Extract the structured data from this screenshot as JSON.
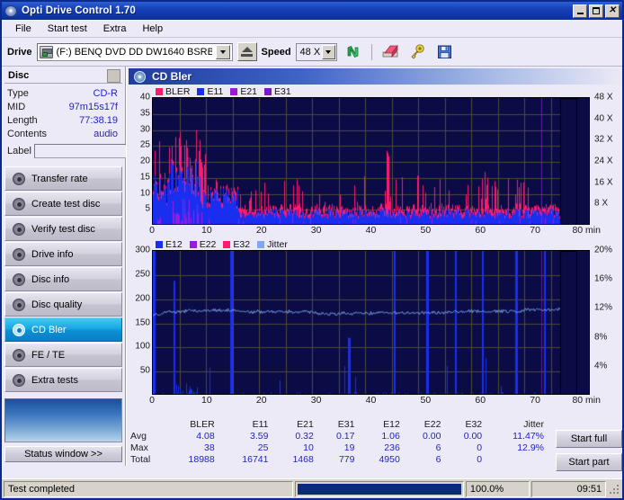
{
  "window": {
    "title": "Opti Drive Control 1.70",
    "icon": "disc-icon",
    "controls": {
      "minimize": "_",
      "maximize": "□",
      "close": "✕"
    }
  },
  "menu": {
    "items": [
      {
        "name": "file",
        "label": "File"
      },
      {
        "name": "start-test",
        "label": "Start test"
      },
      {
        "name": "extra",
        "label": "Extra"
      },
      {
        "name": "help",
        "label": "Help"
      }
    ]
  },
  "toolbar": {
    "drive_label": "Drive",
    "drive_value": "(F:)   BENQ DVD DD DW1640 BSRB",
    "eject_icon": "eject-icon",
    "speed_label": "Speed",
    "speed_value": "48 X",
    "refresh_icon": "refresh-icon",
    "eraser_icon": "eraser-icon",
    "key_icon": "key-icon",
    "save_icon": "save-icon"
  },
  "sidebar": {
    "disc_header": "Disc",
    "disc_info": [
      {
        "key": "Type",
        "value": "CD-R"
      },
      {
        "key": "MID",
        "value": "97m15s17f"
      },
      {
        "key": "Length",
        "value": "77:38.19"
      },
      {
        "key": "Contents",
        "value": "audio"
      }
    ],
    "label_field": {
      "label": "Label",
      "value": "",
      "placeholder": ""
    },
    "label_button_icon": "cd-icon",
    "nav_items": [
      {
        "name": "transfer-rate",
        "label": "Transfer rate",
        "active": false
      },
      {
        "name": "create-test-disc",
        "label": "Create test disc",
        "active": false
      },
      {
        "name": "verify-test-disc",
        "label": "Verify test disc",
        "active": false
      },
      {
        "name": "drive-info",
        "label": "Drive info",
        "active": false
      },
      {
        "name": "disc-info",
        "label": "Disc info",
        "active": false
      },
      {
        "name": "disc-quality",
        "label": "Disc quality",
        "active": false
      },
      {
        "name": "cd-bler",
        "label": "CD Bler",
        "active": true
      },
      {
        "name": "fe-te",
        "label": "FE / TE",
        "active": false
      },
      {
        "name": "extra-tests",
        "label": "Extra tests",
        "active": false
      }
    ],
    "status_window_button": "Status window >>"
  },
  "main": {
    "panel_title": "CD Bler",
    "buttons": [
      {
        "name": "start-full-button",
        "label": "Start full"
      },
      {
        "name": "start-part-button",
        "label": "Start part"
      }
    ]
  },
  "statusbar": {
    "message": "Test completed",
    "progress_percent": "100.0%",
    "progress_value": 100,
    "elapsed": "09:51"
  },
  "stats": {
    "columns": [
      "BLER",
      "E11",
      "E21",
      "E31",
      "E12",
      "E22",
      "E32",
      "Jitter"
    ],
    "rows": [
      {
        "label": "Avg",
        "values": [
          "4.08",
          "3.59",
          "0.32",
          "0.17",
          "1.06",
          "0.00",
          "0.00",
          "11.47%"
        ]
      },
      {
        "label": "Max",
        "values": [
          "38",
          "25",
          "10",
          "19",
          "236",
          "6",
          "0",
          "12.9%"
        ]
      },
      {
        "label": "Total",
        "values": [
          "18988",
          "16741",
          "1468",
          "779",
          "4950",
          "6",
          "0",
          ""
        ]
      }
    ]
  },
  "colors": {
    "bler": "#ff1a6e",
    "e11": "#1a2ef0",
    "e21": "#9b1ae0",
    "e31": "#7a1ad0",
    "e12": "#1a2ef0",
    "e22": "#9b1ae0",
    "e32": "#ff1a6e",
    "jitter": "#7fa8ef",
    "plot_bg": "#0b0b46",
    "grid": "#4d4d3a",
    "accent": "#0b8fd4",
    "link_blue": "#2222cc"
  },
  "chart_data": [
    {
      "type": "area",
      "name": "cd-bler-errors",
      "title": "CD Bler",
      "xlabel": "min",
      "ylabel": "",
      "xlim": [
        0,
        80
      ],
      "ylim": [
        0,
        40
      ],
      "xticks": [
        0,
        10,
        20,
        30,
        40,
        50,
        60,
        70,
        80
      ],
      "xticklabels": [
        "0",
        "10",
        "20",
        "30",
        "40",
        "50",
        "60",
        "70",
        "80 min"
      ],
      "yticks": [
        5,
        10,
        15,
        20,
        25,
        30,
        35,
        40
      ],
      "y2label": "",
      "y2lim": [
        0,
        48
      ],
      "y2ticks": [
        8,
        16,
        24,
        32,
        40,
        48
      ],
      "y2ticklabels": [
        "8 X",
        "16 X",
        "24 X",
        "32 X",
        "40 X",
        "48 X"
      ],
      "grid": true,
      "legend": [
        {
          "label": "BLER",
          "color": "#ff1a6e"
        },
        {
          "label": "E11",
          "color": "#1a2ef0"
        },
        {
          "label": "E21",
          "color": "#9b1ae0"
        },
        {
          "label": "E31",
          "color": "#7a1ad0"
        }
      ],
      "series": [
        {
          "name": "BLER",
          "color": "#ff1a6e",
          "avg": 4.08,
          "max": 38,
          "total": 18988
        },
        {
          "name": "E11",
          "color": "#1a2ef0",
          "avg": 3.59,
          "max": 25,
          "total": 16741
        },
        {
          "name": "E21",
          "color": "#9b1ae0",
          "avg": 0.32,
          "max": 10,
          "total": 1468
        },
        {
          "name": "E31",
          "color": "#7a1ad0",
          "avg": 0.17,
          "max": 19,
          "total": 779
        }
      ]
    },
    {
      "type": "line",
      "name": "cd-bler-jitter",
      "title": "",
      "xlabel": "min",
      "ylabel": "",
      "xlim": [
        0,
        80
      ],
      "ylim": [
        0,
        300
      ],
      "xticks": [
        0,
        10,
        20,
        30,
        40,
        50,
        60,
        70,
        80
      ],
      "xticklabels": [
        "0",
        "10",
        "20",
        "30",
        "40",
        "50",
        "60",
        "70",
        "80 min"
      ],
      "yticks": [
        50,
        100,
        150,
        200,
        250,
        300
      ],
      "y2lim": [
        0,
        20
      ],
      "y2ticks": [
        4,
        8,
        12,
        16,
        20
      ],
      "y2ticklabels": [
        "4%",
        "8%",
        "12%",
        "16%",
        "20%"
      ],
      "grid": true,
      "legend": [
        {
          "label": "E12",
          "color": "#1a2ef0"
        },
        {
          "label": "E22",
          "color": "#9b1ae0"
        },
        {
          "label": "E32",
          "color": "#ff1a6e"
        },
        {
          "label": "Jitter",
          "color": "#7fa8ef"
        }
      ],
      "series": [
        {
          "name": "E12",
          "color": "#1a2ef0",
          "avg": 1.06,
          "max": 236,
          "total": 4950
        },
        {
          "name": "E22",
          "color": "#9b1ae0",
          "avg": 0.0,
          "max": 6,
          "total": 6
        },
        {
          "name": "E32",
          "color": "#ff1a6e",
          "avg": 0.0,
          "max": 0,
          "total": 0
        },
        {
          "name": "Jitter",
          "color": "#7fa8ef",
          "avg": 11.47,
          "max": 12.9,
          "unit": "%"
        }
      ]
    }
  ]
}
